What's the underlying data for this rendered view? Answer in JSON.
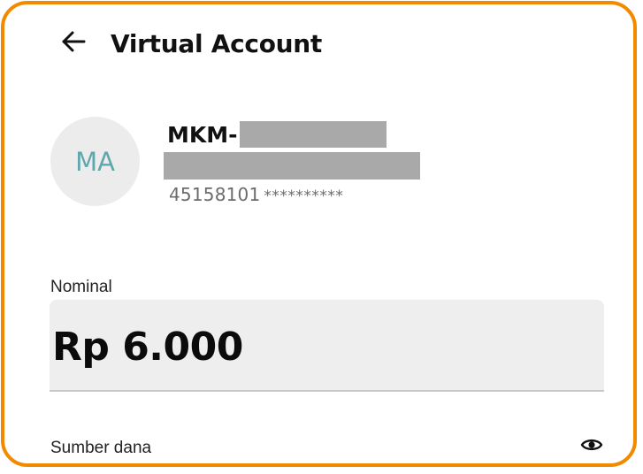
{
  "header": {
    "back_icon": "arrow-left-icon",
    "title": "Virtual Account"
  },
  "account": {
    "avatar_initials": "MA",
    "name_prefix": "MKM-",
    "number": "45158101",
    "masked_number": "**********"
  },
  "nominal": {
    "label": "Nominal",
    "amount": "Rp 6.000"
  },
  "source": {
    "label": "Sumber dana",
    "toggle_icon": "eye-icon"
  },
  "colors": {
    "frame": "#f28a00",
    "avatar_bg": "#ececec",
    "avatar_text": "#5fa7ac",
    "input_bg": "#eeeeee",
    "redaction": "#a9a9a9"
  }
}
